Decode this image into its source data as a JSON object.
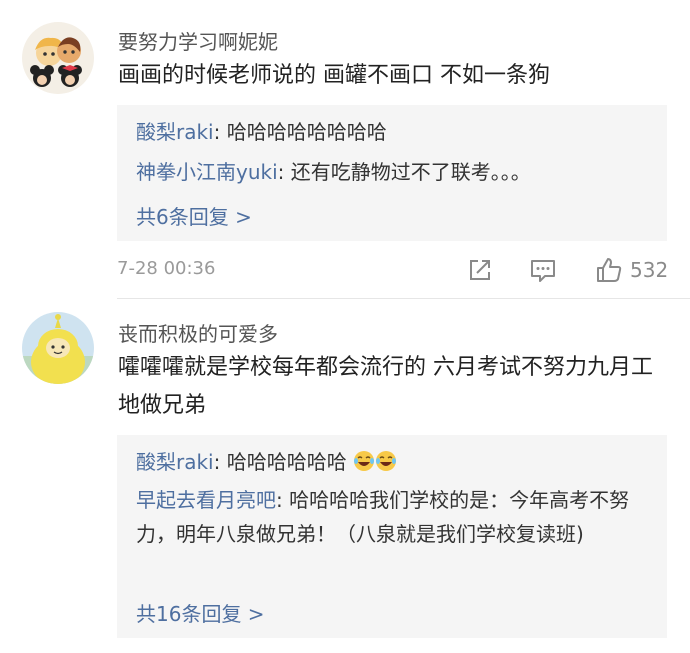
{
  "comments": [
    {
      "username": "要努力学习啊妮妮",
      "content": "画画的时候老师说的 画罐不画口 不如一条狗",
      "replies": [
        {
          "name": "酸梨raki",
          "sep": ": ",
          "text": "哈哈哈哈哈哈哈哈"
        },
        {
          "name": "神拳小江南yuki",
          "sep": ": ",
          "text": "还有吃静物过不了联考。。。"
        }
      ],
      "more_replies": "共6条回复 >",
      "timestamp": "7-28 00:36",
      "likes": "532"
    },
    {
      "username": "丧而积极的可爱多",
      "content": "嚯嚯嚯就是学校每年都会流行的 六月考试不努力九月工地做兄弟",
      "replies": [
        {
          "name": "酸梨raki",
          "sep": ": ",
          "text": "哈哈哈哈哈哈"
        },
        {
          "name": "早起去看月亮吧",
          "sep": ": ",
          "text": "哈哈哈哈我们学校的是：今年高考不努力，明年八泉做兄弟！（八泉就是我们学校复读班)"
        }
      ],
      "more_replies": "共16条回复 >"
    }
  ],
  "icons": {
    "share": "share-icon",
    "comment": "comment-icon",
    "like": "thumbs-up-icon",
    "emoji": "laughing-tears-emoji"
  },
  "colors": {
    "link": "#4e6fa0",
    "reply_bg": "#f5f5f5",
    "meta": "#9a9a9a"
  }
}
